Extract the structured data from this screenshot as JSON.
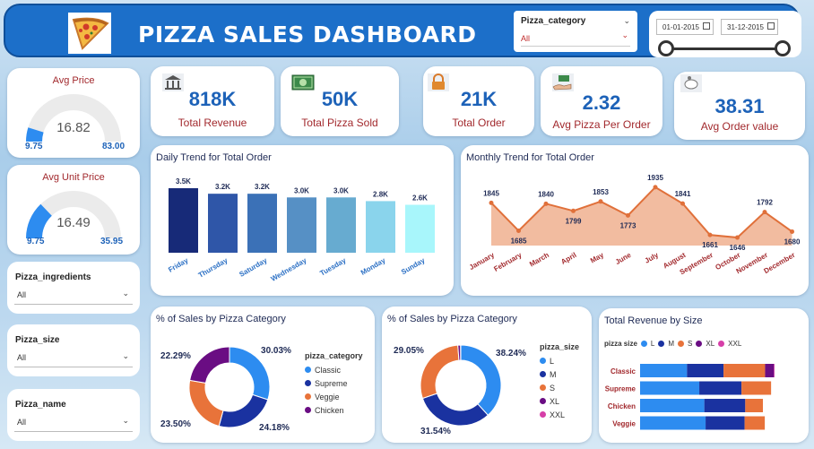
{
  "header": {
    "title": "PIZZA SALES DASHBOARD",
    "category_slicer": {
      "label": "Pizza_category",
      "value": "All"
    },
    "date_slicer": {
      "start": "01-01-2015",
      "end": "31-12-2015"
    }
  },
  "kpis": [
    {
      "value": "818K",
      "label": "Total Revenue",
      "icon": "bank-icon"
    },
    {
      "value": "50K",
      "label": "Total Pizza Sold",
      "icon": "cash-icon"
    },
    {
      "value": "21K",
      "label": "Total Order",
      "icon": "lock-icon"
    },
    {
      "value": "2.32",
      "label": "Avg Pizza Per Order",
      "icon": "hand-money-icon"
    },
    {
      "value": "38.31",
      "label": "Avg Order value",
      "icon": "piggy-bank-icon"
    }
  ],
  "gauges": [
    {
      "title": "Avg Price",
      "value": "16.82",
      "min": "9.75",
      "max": "83.00",
      "fill": 0.096
    },
    {
      "title": "Avg Unit Price",
      "value": "16.49",
      "min": "9.75",
      "max": "35.95",
      "fill": 0.257
    }
  ],
  "side_slicers": [
    {
      "label": "Pizza_ingredients",
      "value": "All"
    },
    {
      "label": "Pizza_size",
      "value": "All"
    },
    {
      "label": "Pizza_name",
      "value": "All"
    }
  ],
  "colors": {
    "accent": "#1c6fc9",
    "kpi_value": "#1d62b8",
    "label_red": "#a2292d"
  },
  "chart_data": [
    {
      "type": "bar",
      "title": "Daily Trend for Total Order",
      "categories": [
        "Friday",
        "Thursday",
        "Saturday",
        "Wednesday",
        "Tuesday",
        "Monday",
        "Sunday"
      ],
      "values": [
        3.5,
        3.2,
        3.2,
        3.0,
        3.0,
        2.8,
        2.6
      ],
      "labels": [
        "3.5K",
        "3.2K",
        "3.2K",
        "3.0K",
        "3.0K",
        "2.8K",
        "2.6K"
      ],
      "colors": [
        "#172a78",
        "#2f56a8",
        "#3b71b7",
        "#5690c5",
        "#67abd0",
        "#8ad4ec",
        "#a8f6fb"
      ]
    },
    {
      "type": "area",
      "title": "Monthly Trend for Total Order",
      "categories": [
        "January",
        "February",
        "March",
        "April",
        "May",
        "June",
        "July",
        "August",
        "September",
        "October",
        "November",
        "December"
      ],
      "values": [
        1845,
        1685,
        1840,
        1799,
        1853,
        1773,
        1935,
        1841,
        1661,
        1646,
        1792,
        1680
      ]
    },
    {
      "type": "pie",
      "title": "% of Sales by Pizza Category",
      "legend_title": "pizza_category",
      "series": [
        {
          "name": "Classic",
          "value": 30.03,
          "label": "30.03%",
          "color": "#2d8cf0"
        },
        {
          "name": "Supreme",
          "value": 24.18,
          "label": "24.18%",
          "color": "#1a32a0"
        },
        {
          "name": "Veggie",
          "value": 23.5,
          "label": "23.50%",
          "color": "#e8733a"
        },
        {
          "name": "Chicken",
          "value": 22.29,
          "label": "22.29%",
          "color": "#6a0d83"
        }
      ]
    },
    {
      "type": "pie",
      "title": "% of Sales by Pizza Category",
      "legend_title": "pizza_size",
      "series": [
        {
          "name": "L",
          "value": 38.24,
          "label": "38.24%",
          "color": "#2d8cf0"
        },
        {
          "name": "M",
          "value": 31.54,
          "label": "31.54%",
          "color": "#1a32a0"
        },
        {
          "name": "S",
          "value": 29.05,
          "label": "29.05%",
          "color": "#e8733a"
        },
        {
          "name": "XL",
          "value": 1.1,
          "label": "",
          "color": "#6a0d83"
        },
        {
          "name": "XXL",
          "value": 0.07,
          "label": "",
          "color": "#d63fa8"
        }
      ]
    },
    {
      "type": "bar",
      "title": "Total Revenue by Size",
      "legend_title": "pizza size",
      "categories": [
        "Classic",
        "Supreme",
        "Chicken",
        "Veggie"
      ],
      "series": [
        {
          "name": "L",
          "color": "#2d8cf0",
          "values": [
            74500,
            94000,
            102000,
            104000
          ]
        },
        {
          "name": "M",
          "color": "#1a32a0",
          "values": [
            58000,
            67000,
            65000,
            62000
          ]
        },
        {
          "name": "S",
          "color": "#e8733a",
          "values": [
            66000,
            47000,
            28000,
            32000
          ]
        },
        {
          "name": "XL",
          "color": "#6a0d83",
          "values": [
            14000,
            0,
            0,
            0
          ]
        },
        {
          "name": "XXL",
          "color": "#d63fa8",
          "values": [
            1000,
            0,
            0,
            0
          ]
        }
      ]
    }
  ]
}
